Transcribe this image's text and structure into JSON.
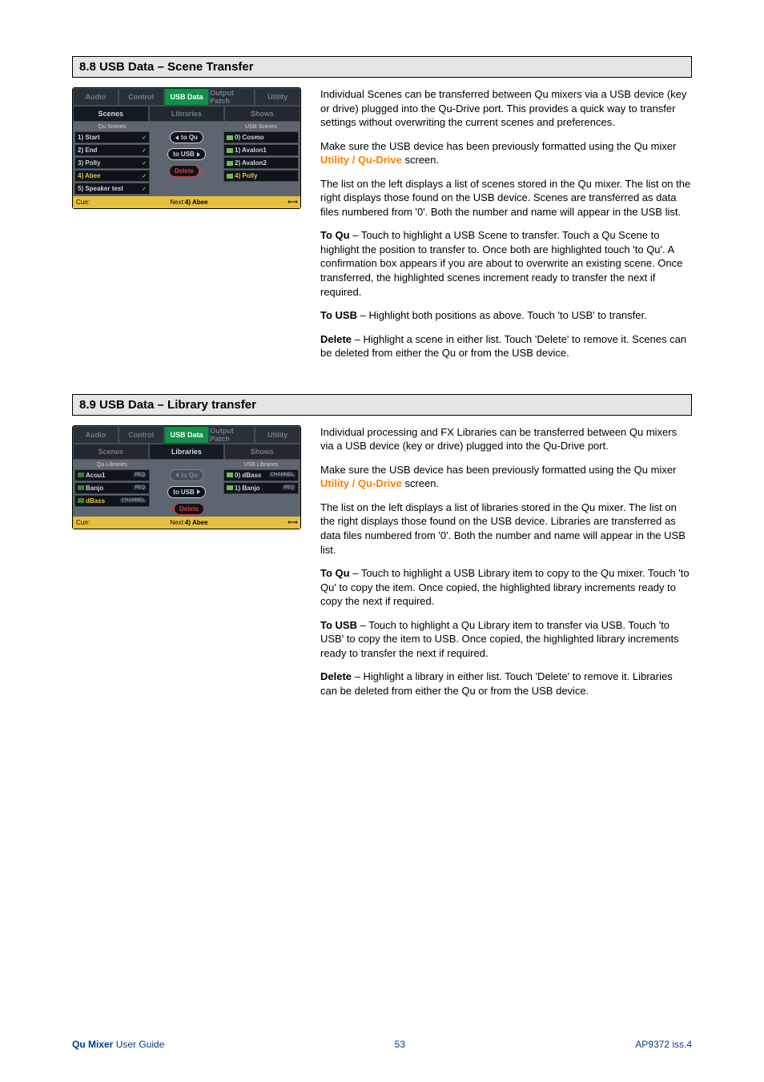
{
  "sections": {
    "s88": {
      "header": "8.8  USB Data – Scene Transfer",
      "body": {
        "p1": "Individual Scenes can be transferred between Qu mixers via a USB device (key or drive) plugged into the Qu-Drive port. This provides a quick way to transfer settings without overwriting the current scenes and preferences.",
        "p2a": "Make sure the USB device has been previously formatted using the Qu mixer ",
        "p2_orange": "Utility / Qu-Drive",
        "p2b": " screen.",
        "p3": "The list on the left displays a list of scenes stored in the Qu mixer. The list on the right displays those found on the USB device. Scenes are transferred as data files numbered from '0'. Both the number and name will appear in the USB list.",
        "p4_bold": "To Qu",
        "p4": " – Touch to highlight a USB Scene to transfer. Touch a Qu Scene to highlight the position to transfer to. Once both are highlighted touch 'to Qu'. A confirmation box appears if you are about to overwrite an existing scene. Once transferred, the highlighted scenes increment ready to transfer the next if required.",
        "p5_bold": "To USB",
        "p5": " – Highlight both positions as above. Touch 'to USB' to transfer.",
        "p6_bold": "Delete",
        "p6": " – Highlight a scene in either list. Touch 'Delete' to remove it. Scenes can be deleted from either the Qu or from the USB device."
      }
    },
    "s89": {
      "header": "8.9  USB Data – Library transfer",
      "body": {
        "p1": "Individual processing and FX Libraries can be transferred between Qu mixers via a USB device (key or drive) plugged into the Qu-Drive port.",
        "p2a": "Make sure the USB device has been previously formatted using the Qu mixer ",
        "p2_orange": "Utility / Qu-Drive",
        "p2b": " screen.",
        "p3": "The list on the left displays a list of libraries stored in the Qu mixer. The list on the right displays those found on the USB device. Libraries are transferred as data files numbered from '0'. Both the number and name will appear in the USB list.",
        "p4_bold": "To Qu",
        "p4": " – Touch to highlight a USB Library item to copy to the Qu mixer. Touch 'to Qu' to copy the item. Once copied, the highlighted library increments ready to copy the next if required.",
        "p5_bold": "To USB",
        "p5": " – Touch to highlight a Qu Library item to transfer via USB. Touch 'to USB' to copy the item to USB. Once copied, the highlighted library increments ready to transfer the next if required.",
        "p6_bold": "Delete",
        "p6": " – Highlight a library in either list. Touch 'Delete' to remove it. Libraries can be deleted from either the Qu or from the USB device."
      }
    }
  },
  "screenshot_tabs": {
    "audio": "Audio",
    "control": "Control",
    "usbdata": "USB Data",
    "outputpatch": "Output Patch",
    "utility": "Utility"
  },
  "screenshot_subtabs": {
    "scenes": "Scenes",
    "libraries": "Libraries",
    "shows": "Shows"
  },
  "scene_panel": {
    "left_header": "Qu Scenes",
    "right_header": "USB Scenes",
    "left_items": [
      "1) Start",
      "2) End",
      "3) Polly",
      "4) Abee",
      "5) Speaker test"
    ],
    "right_items": [
      "0) Cosmo",
      "1) Avalon1",
      "2) Avalon2",
      "4) Polly"
    ],
    "btn_toqu": "to Qu",
    "btn_tousb": "to USB",
    "btn_delete": "Delete",
    "status_curr": "Curr:",
    "status_next_label": "Next:",
    "status_next_value": "4) Abee"
  },
  "lib_panel": {
    "left_header": "Qu Libraries",
    "right_header": "USB Libraries",
    "left_items": [
      {
        "name": "Acou1",
        "tag": "PEQ"
      },
      {
        "name": "Banjo",
        "tag": "PEQ"
      },
      {
        "name": "dBass",
        "tag": "CHANNEL"
      }
    ],
    "right_items": [
      {
        "name": "0) dBass",
        "tag": "CHANNEL"
      },
      {
        "name": "1) Banjo",
        "tag": "PEQ"
      }
    ],
    "btn_toqu": "to Qu",
    "btn_tousb": "to USB",
    "btn_delete": "Delete",
    "status_curr": "Curr:",
    "status_next_label": "Next:",
    "status_next_value": "4) Abee"
  },
  "footer": {
    "left_bold": "Qu Mixer",
    "left_text": " User Guide",
    "page": "53",
    "right": "AP9372 iss.4"
  }
}
